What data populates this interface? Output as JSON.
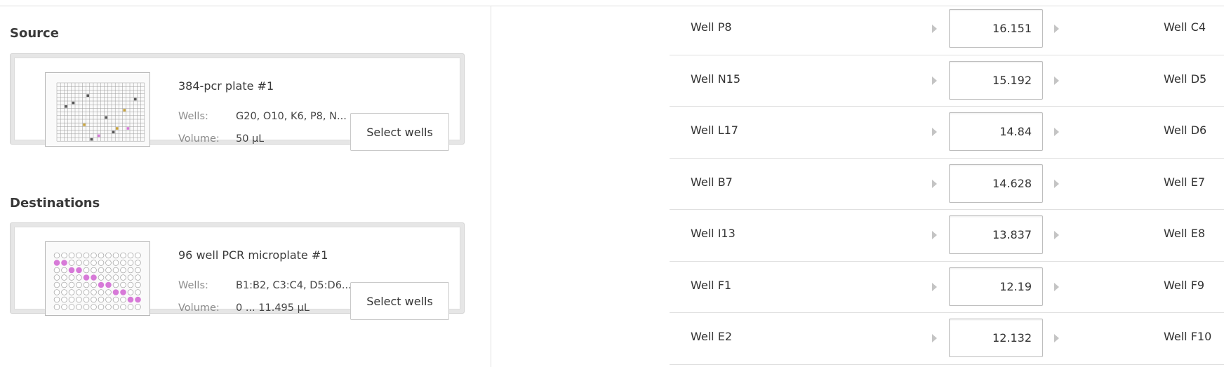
{
  "source": {
    "section_title": "Source",
    "plate_name": "384-pcr plate #1",
    "wells_label": "Wells:",
    "wells_value": "G20, O10, K6, P8, N...",
    "volume_label": "Volume:",
    "volume_value": "50 µL",
    "select_button": "Select wells",
    "thumbnail_icon": "plate-384-thumbnail"
  },
  "destinations": {
    "section_title": "Destinations",
    "plate_name": "96 well PCR microplate #1",
    "wells_label": "Wells:",
    "wells_value": "B1:B2, C3:C4, D5:D6...",
    "volume_label": "Volume:",
    "volume_value": "0 ... 11.495 µL",
    "select_button": "Select wells",
    "thumbnail_icon": "plate-96-thumbnail"
  },
  "transfers": [
    {
      "source": "Well P8",
      "volume": "16.151",
      "destination": "Well C4"
    },
    {
      "source": "Well N15",
      "volume": "15.192",
      "destination": "Well D5"
    },
    {
      "source": "Well L17",
      "volume": "14.84",
      "destination": "Well D6"
    },
    {
      "source": "Well B7",
      "volume": "14.628",
      "destination": "Well E7"
    },
    {
      "source": "Well I13",
      "volume": "13.837",
      "destination": "Well E8"
    },
    {
      "source": "Well F1",
      "volume": "12.19",
      "destination": "Well F9"
    },
    {
      "source": "Well E2",
      "volume": "12.132",
      "destination": "Well F10"
    }
  ],
  "colors": {
    "highlight_pink": "#d77ad8",
    "highlight_gold": "#c9a43d",
    "well_dark": "#555555"
  }
}
